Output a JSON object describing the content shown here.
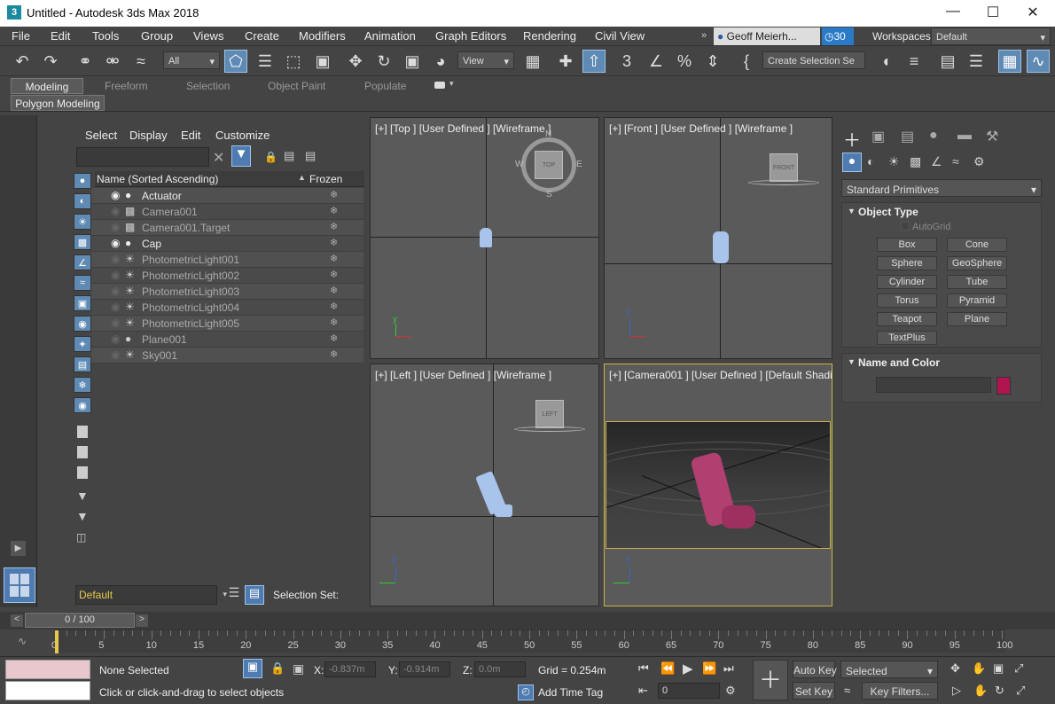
{
  "title": "Untitled - Autodesk 3ds Max 2018",
  "menu": [
    "File",
    "Edit",
    "Tools",
    "Group",
    "Views",
    "Create",
    "Modifiers",
    "Animation",
    "Graph Editors",
    "Rendering",
    "Civil View"
  ],
  "user": {
    "name": "Geoff Meierh...",
    "notifications": "30"
  },
  "workspaces": {
    "label": "Workspaces:",
    "value": "Default"
  },
  "toolbar": {
    "filter": "All",
    "view": "View",
    "create_selection_set": "Create Selection Se"
  },
  "ribbon": {
    "tabs": [
      "Modeling",
      "Freeform",
      "Selection",
      "Object Paint",
      "Populate"
    ],
    "sub": "Polygon Modeling"
  },
  "explorer": {
    "menus": [
      "Select",
      "Display",
      "Edit",
      "Customize"
    ],
    "col_name": "Name (Sorted Ascending)",
    "col_frozen": "Frozen",
    "rows": [
      {
        "name": "Actuator",
        "icon": "geometry-icon"
      },
      {
        "name": "Camera001",
        "icon": "camera-icon"
      },
      {
        "name": "Camera001.Target",
        "icon": "camera-target-icon"
      },
      {
        "name": "Cap",
        "icon": "geometry-icon"
      },
      {
        "name": "PhotometricLight001",
        "icon": "light-icon"
      },
      {
        "name": "PhotometricLight002",
        "icon": "light-icon"
      },
      {
        "name": "PhotometricLight003",
        "icon": "light-icon"
      },
      {
        "name": "PhotometricLight004",
        "icon": "light-icon"
      },
      {
        "name": "PhotometricLight005",
        "icon": "light-icon"
      },
      {
        "name": "Plane001",
        "icon": "geometry-icon"
      },
      {
        "name": "Sky001",
        "icon": "light-icon"
      }
    ],
    "layer": "Default",
    "selection_set": "Selection Set:"
  },
  "viewports": {
    "top": "[+] [Top ] [User Defined ] [Wireframe ]",
    "front": "[+] [Front ] [User Defined ] [Wireframe ]",
    "left": "[+] [Left ] [User Defined ] [Wireframe ]",
    "camera": "[+] [Camera001 ] [User Defined ] [Default Shading ]",
    "cube_top": "TOP",
    "cube_front": "FRONT",
    "cube_left": "LEFT",
    "compass": {
      "n": "N",
      "s": "S",
      "e": "E",
      "w": "W"
    }
  },
  "command_panel": {
    "category": "Standard Primitives",
    "object_type": "Object Type",
    "autogrid": "AutoGrid",
    "buttons": [
      "Box",
      "Cone",
      "Sphere",
      "GeoSphere",
      "Cylinder",
      "Tube",
      "Torus",
      "Pyramid",
      "Teapot",
      "Plane",
      "TextPlus"
    ],
    "name_and_color": "Name and Color",
    "color": "#b0154f"
  },
  "timeline": {
    "frame": "0 / 100",
    "ticks": [
      "0",
      "5",
      "10",
      "15",
      "20",
      "25",
      "30",
      "35",
      "40",
      "45",
      "50",
      "55",
      "60",
      "65",
      "70",
      "75",
      "80",
      "85",
      "90",
      "95",
      "100"
    ]
  },
  "status": {
    "selected": "None Selected",
    "hint": "Click or click-and-drag to select objects",
    "x": "-0.837m",
    "y": "-0.914m",
    "z": "0.0m",
    "grid": "Grid = 0.254m",
    "add_time_tag": "Add Time Tag",
    "auto_key": "Auto Key",
    "set_key": "Set Key",
    "selected_dd": "Selected",
    "key_filters": "Key Filters...",
    "frame_field": "0",
    "x_label": "X:",
    "y_label": "Y:",
    "z_label": "Z:"
  }
}
